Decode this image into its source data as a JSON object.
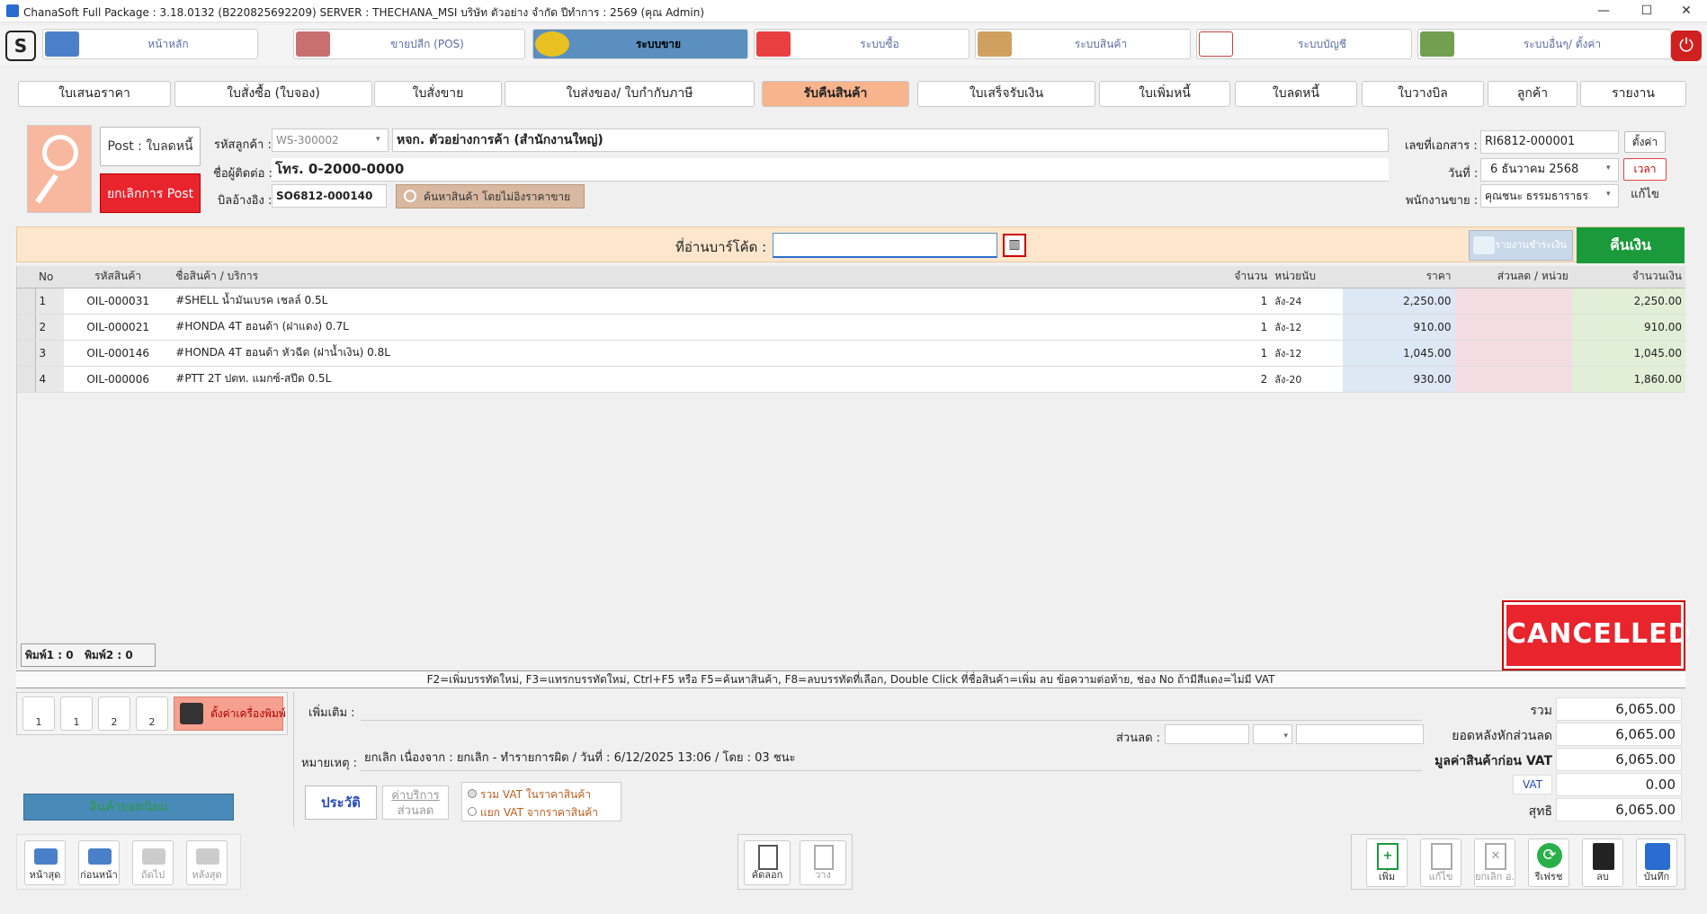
{
  "window": {
    "title": "ChanaSoft Full Package : 3.18.0132 (B220825692209) SERVER : THECHANA_MSI บริษัท ตัวอย่าง จำกัด ปีทำการ : 2569 (คุณ Admin)",
    "minimize": "—",
    "maximize": "☐",
    "close": "✕"
  },
  "menu": [
    {
      "label": "หน้าหลัก",
      "color": "#4a80c8"
    },
    {
      "label": "ขายปลีก (POS)",
      "color": "#c84040"
    },
    {
      "label": "ระบบขาย",
      "color": "#e8c020"
    },
    {
      "label": "ระบบซื้อ",
      "color": "#e84040"
    },
    {
      "label": "ระบบสินค้า",
      "color": "#d0a060"
    },
    {
      "label": "ระบบบัญชี",
      "color": "#d04040"
    },
    {
      "label": "ระบบอื่นๆ/ ตั้งค่า",
      "color": "#70a050"
    }
  ],
  "doctabs": [
    "ใบเสนอราคา",
    "ใบสั่งซื้อ (ใบจอง)",
    "ใบสั่งขาย",
    "ใบส่งของ/ ใบกำกับภาษี",
    "รับคืนสินค้า",
    "ใบเสร็จรับเงิน",
    "ใบเพิ่มหนี้",
    "ใบลดหนี้",
    "ใบวางบิล",
    "ลูกค้า",
    "รายงาน"
  ],
  "header": {
    "post_label": "Post : ใบลดหนี้",
    "cancel_post": "ยกเลิกการ Post",
    "customer_code_label": "รหัสลูกค้า :",
    "customer_code": "WS-300002",
    "customer_name": "หจก. ตัวอย่างการค้า (สำนักงานใหญ่)",
    "contact_label": "ชื่อผู้ติดต่อ :",
    "contact": "โทร. 0-2000-0000",
    "ref_label": "บิลอ้างอิง :",
    "ref": "SO6812-000140",
    "search_btn": "ค้นหาสินค้า โดยไม่อิงราคาขาย",
    "docno_label": "เลขที่เอกสาร :",
    "docno": "RI6812-000001",
    "settings_btn": "ตั้งค่า",
    "date_label": "วันที่ :",
    "date": "6  ธันวาคม   2568",
    "time_btn": "เวลา",
    "salesman_label": "พนักงานขาย :",
    "salesman": "คุณชนะ ธรรมธาราธร",
    "edit_btn": "แก้ไข"
  },
  "barcode": {
    "label": "ที่อ่านบาร์โค้ด :",
    "value": "",
    "print_btn": "รายงานชำระเงิน",
    "refund_btn": "คืนเงิน"
  },
  "grid": {
    "columns": [
      "No",
      "รหัสสินค้า",
      "ชื่อสินค้า / บริการ",
      "จำนวน",
      "หน่วยนับ",
      "ราคา",
      "ส่วนลด / หน่วย",
      "จำนวนเงิน"
    ],
    "rows": [
      [
        "1",
        "OIL-000031",
        "#SHELL น้ำมันเบรค เชลล์ 0.5L",
        "1",
        "ลัง-24",
        "2,250.00",
        "",
        "2,250.00"
      ],
      [
        "2",
        "OIL-000021",
        "#HONDA 4T ฮอนด้า (ฝาแดง) 0.7L",
        "1",
        "ลัง-12",
        "910.00",
        "",
        "910.00"
      ],
      [
        "3",
        "OIL-000146",
        "#HONDA 4T ฮอนด้า หัวฉีด (ฝาน้ำเงิน) 0.8L",
        "1",
        "ลัง-12",
        "1,045.00",
        "",
        "1,045.00"
      ],
      [
        "4",
        "OIL-000006",
        "#PTT 2T ปตท. แมกซ์-สปีด 0.5L",
        "2",
        "ลัง-20",
        "930.00",
        "",
        "1,860.00"
      ]
    ]
  },
  "print_counts": {
    "p1": "พิมพ์1 : 0",
    "p2": "พิมพ์2 : 0"
  },
  "cancelled": "CANCELLED",
  "help": "F2=เพิ่มบรรทัดใหม่,  F3=แทรกบรรทัดใหม่,  Ctrl+F5 หรือ F5=ค้นหาสินค้า,  F8=ลบบรรทัดที่เลือก,  Double Click ที่ชื่อสินค้า=เพิ่ม ลบ ข้อความต่อท้าย,  ช่อง No ถ้ามีสีแดง=ไม่มี VAT",
  "footer": {
    "printer_setup": "ตั้งค่าเครื่องพิมพ์",
    "print_btns": [
      "1",
      "1",
      "2",
      "2"
    ],
    "popular": "สินค้ายอดนิยม",
    "extra_label": "เพิ่มเติม :",
    "extra": "",
    "discount_label": "ส่วนลด :",
    "note_label": "หมายเหตุ :",
    "note": "ยกเลิก เนื่องจาก : ยกเลิก - ทำรายการผิด / วันที่ : 6/12/2025 13:06 / โดย : 03 ชนะ",
    "history_btn": "ประวัติ",
    "service_btn": "ค่าบริการ",
    "discount_btn": "ส่วนลด",
    "vat_incl": "รวม VAT ในราคาสินค้า",
    "vat_excl": "แยก VAT จากราคาสินค้า",
    "nav": [
      "หน้าสุด",
      "ก่อนหน้า",
      "ถัดไป",
      "หลังสุด"
    ],
    "copy": "คัดลอก",
    "paste": "วาง",
    "actions": [
      "เพิ่ม",
      "แก้ไข",
      "ยกเลิก อ.",
      "รีเฟรช",
      "ลบ",
      "บันทึก"
    ]
  },
  "totals": [
    {
      "label": "รวม",
      "value": "6,065.00"
    },
    {
      "label": "ยอดหลังหักส่วนลด",
      "value": "6,065.00"
    },
    {
      "label": "มูลค่าสินค้าก่อน VAT",
      "value": "6,065.00"
    },
    {
      "label": "VAT",
      "value": "0.00"
    },
    {
      "label": "สุทธิ",
      "value": "6,065.00"
    }
  ]
}
